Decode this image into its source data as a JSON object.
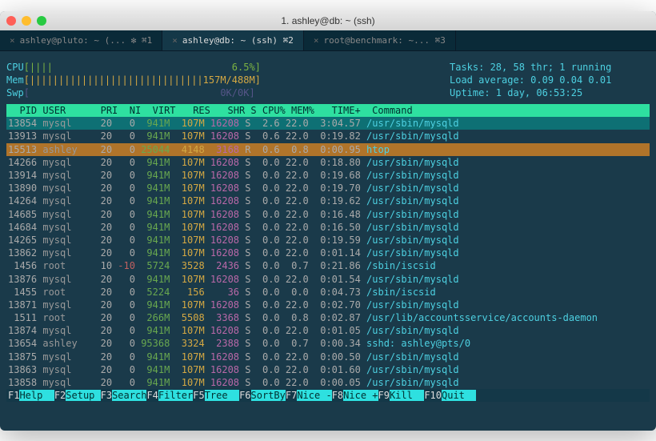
{
  "window": {
    "title": "1. ashley@db: ~ (ssh)"
  },
  "tabs": [
    {
      "label": "ashley@pluto: ~ (... ✻ ⌘1",
      "active": false
    },
    {
      "label": "ashley@db: ~ (ssh)   ⌘2",
      "active": true
    },
    {
      "label": "root@benchmark: ~... ⌘3",
      "active": false
    }
  ],
  "summary": {
    "cpu_label": "CPU",
    "cpu_bar": "[||||                               6.5%]",
    "mem_label": "Mem",
    "mem_bar": "[||||||||||||||||||||||||||||||157M/488M]",
    "swp_label": "Swp",
    "swp_bar": "[                                 0K/0K]",
    "tasks": "Tasks: 28, 58 thr; 1 running",
    "loadavg": "Load average: 0.09 0.04 0.01",
    "uptime": "Uptime: 1 day, 06:53:25"
  },
  "columns": "  PID USER      PRI  NI  VIRT   RES   SHR S CPU% MEM%   TIME+  Command",
  "processes": [
    {
      "pid": "13854",
      "user": "mysql ",
      "pri": "20",
      "ni": "  0",
      "virt": " 941M",
      "res": " 107M",
      "shr": "16208",
      "s": "S",
      "cpu": " 2.6",
      "mem": "22.0",
      "time": " 3:04.57",
      "cmd": "/usr/sbin/mysqld",
      "style": "hilite-cyan"
    },
    {
      "pid": "13913",
      "user": "mysql ",
      "pri": "20",
      "ni": "  0",
      "virt": " 941M",
      "res": " 107M",
      "shr": "16208",
      "s": "S",
      "cpu": " 0.6",
      "mem": "22.0",
      "time": " 0:19.82",
      "cmd": "/usr/sbin/mysqld",
      "style": ""
    },
    {
      "pid": "15513",
      "user": "ashley",
      "pri": "20",
      "ni": "  0",
      "virt": "25044",
      "res": " 4148",
      "shr": " 3168",
      "s": "R",
      "cpu": " 0.6",
      "mem": " 0.8",
      "time": " 0:00.95",
      "cmd": "htop",
      "style": "hilite-orange"
    },
    {
      "pid": "14266",
      "user": "mysql ",
      "pri": "20",
      "ni": "  0",
      "virt": " 941M",
      "res": " 107M",
      "shr": "16208",
      "s": "S",
      "cpu": " 0.0",
      "mem": "22.0",
      "time": " 0:18.80",
      "cmd": "/usr/sbin/mysqld",
      "style": ""
    },
    {
      "pid": "13914",
      "user": "mysql ",
      "pri": "20",
      "ni": "  0",
      "virt": " 941M",
      "res": " 107M",
      "shr": "16208",
      "s": "S",
      "cpu": " 0.0",
      "mem": "22.0",
      "time": " 0:19.68",
      "cmd": "/usr/sbin/mysqld",
      "style": ""
    },
    {
      "pid": "13890",
      "user": "mysql ",
      "pri": "20",
      "ni": "  0",
      "virt": " 941M",
      "res": " 107M",
      "shr": "16208",
      "s": "S",
      "cpu": " 0.0",
      "mem": "22.0",
      "time": " 0:19.70",
      "cmd": "/usr/sbin/mysqld",
      "style": ""
    },
    {
      "pid": "14264",
      "user": "mysql ",
      "pri": "20",
      "ni": "  0",
      "virt": " 941M",
      "res": " 107M",
      "shr": "16208",
      "s": "S",
      "cpu": " 0.0",
      "mem": "22.0",
      "time": " 0:19.62",
      "cmd": "/usr/sbin/mysqld",
      "style": ""
    },
    {
      "pid": "14685",
      "user": "mysql ",
      "pri": "20",
      "ni": "  0",
      "virt": " 941M",
      "res": " 107M",
      "shr": "16208",
      "s": "S",
      "cpu": " 0.0",
      "mem": "22.0",
      "time": " 0:16.48",
      "cmd": "/usr/sbin/mysqld",
      "style": ""
    },
    {
      "pid": "14684",
      "user": "mysql ",
      "pri": "20",
      "ni": "  0",
      "virt": " 941M",
      "res": " 107M",
      "shr": "16208",
      "s": "S",
      "cpu": " 0.0",
      "mem": "22.0",
      "time": " 0:16.50",
      "cmd": "/usr/sbin/mysqld",
      "style": ""
    },
    {
      "pid": "14265",
      "user": "mysql ",
      "pri": "20",
      "ni": "  0",
      "virt": " 941M",
      "res": " 107M",
      "shr": "16208",
      "s": "S",
      "cpu": " 0.0",
      "mem": "22.0",
      "time": " 0:19.59",
      "cmd": "/usr/sbin/mysqld",
      "style": ""
    },
    {
      "pid": "13862",
      "user": "mysql ",
      "pri": "20",
      "ni": "  0",
      "virt": " 941M",
      "res": " 107M",
      "shr": "16208",
      "s": "S",
      "cpu": " 0.0",
      "mem": "22.0",
      "time": " 0:01.14",
      "cmd": "/usr/sbin/mysqld",
      "style": ""
    },
    {
      "pid": " 1456",
      "user": "root  ",
      "pri": "10",
      "ni": "-10",
      "virt": " 5724",
      "res": " 3528",
      "shr": " 2436",
      "s": "S",
      "cpu": " 0.0",
      "mem": " 0.7",
      "time": " 0:21.86",
      "cmd": "/sbin/iscsid",
      "style": ""
    },
    {
      "pid": "13876",
      "user": "mysql ",
      "pri": "20",
      "ni": "  0",
      "virt": " 941M",
      "res": " 107M",
      "shr": "16208",
      "s": "S",
      "cpu": " 0.0",
      "mem": "22.0",
      "time": " 0:01.54",
      "cmd": "/usr/sbin/mysqld",
      "style": ""
    },
    {
      "pid": " 1455",
      "user": "root  ",
      "pri": "20",
      "ni": "  0",
      "virt": " 5224",
      "res": "  156",
      "shr": "   36",
      "s": "S",
      "cpu": " 0.0",
      "mem": " 0.0",
      "time": " 0:04.73",
      "cmd": "/sbin/iscsid",
      "style": ""
    },
    {
      "pid": "13871",
      "user": "mysql ",
      "pri": "20",
      "ni": "  0",
      "virt": " 941M",
      "res": " 107M",
      "shr": "16208",
      "s": "S",
      "cpu": " 0.0",
      "mem": "22.0",
      "time": " 0:02.70",
      "cmd": "/usr/sbin/mysqld",
      "style": ""
    },
    {
      "pid": " 1511",
      "user": "root  ",
      "pri": "20",
      "ni": "  0",
      "virt": " 266M",
      "res": " 5508",
      "shr": " 3368",
      "s": "S",
      "cpu": " 0.0",
      "mem": " 0.8",
      "time": " 0:02.87",
      "cmd": "/usr/lib/accountsservice/accounts-daemon",
      "style": ""
    },
    {
      "pid": "13874",
      "user": "mysql ",
      "pri": "20",
      "ni": "  0",
      "virt": " 941M",
      "res": " 107M",
      "shr": "16208",
      "s": "S",
      "cpu": " 0.0",
      "mem": "22.0",
      "time": " 0:01.05",
      "cmd": "/usr/sbin/mysqld",
      "style": ""
    },
    {
      "pid": "13654",
      "user": "ashley",
      "pri": "20",
      "ni": "  0",
      "virt": "95368",
      "res": " 3324",
      "shr": " 2388",
      "s": "S",
      "cpu": " 0.0",
      "mem": " 0.7",
      "time": " 0:00.34",
      "cmd": "sshd: ashley@pts/0",
      "style": ""
    },
    {
      "pid": "13875",
      "user": "mysql ",
      "pri": "20",
      "ni": "  0",
      "virt": " 941M",
      "res": " 107M",
      "shr": "16208",
      "s": "S",
      "cpu": " 0.0",
      "mem": "22.0",
      "time": " 0:00.50",
      "cmd": "/usr/sbin/mysqld",
      "style": ""
    },
    {
      "pid": "13863",
      "user": "mysql ",
      "pri": "20",
      "ni": "  0",
      "virt": " 941M",
      "res": " 107M",
      "shr": "16208",
      "s": "S",
      "cpu": " 0.0",
      "mem": "22.0",
      "time": " 0:01.60",
      "cmd": "/usr/sbin/mysqld",
      "style": ""
    },
    {
      "pid": "13858",
      "user": "mysql ",
      "pri": "20",
      "ni": "  0",
      "virt": " 941M",
      "res": " 107M",
      "shr": "16208",
      "s": "S",
      "cpu": " 0.0",
      "mem": "22.0",
      "time": " 0:00.05",
      "cmd": "/usr/sbin/mysqld",
      "style": ""
    }
  ],
  "footer": [
    {
      "key": "F1",
      "label": "Help  "
    },
    {
      "key": "F2",
      "label": "Setup "
    },
    {
      "key": "F3",
      "label": "Search"
    },
    {
      "key": "F4",
      "label": "Filter"
    },
    {
      "key": "F5",
      "label": "Tree  "
    },
    {
      "key": "F6",
      "label": "SortBy"
    },
    {
      "key": "F7",
      "label": "Nice -"
    },
    {
      "key": "F8",
      "label": "Nice +"
    },
    {
      "key": "F9",
      "label": "Kill  "
    },
    {
      "key": "F10",
      "label": "Quit  "
    }
  ]
}
